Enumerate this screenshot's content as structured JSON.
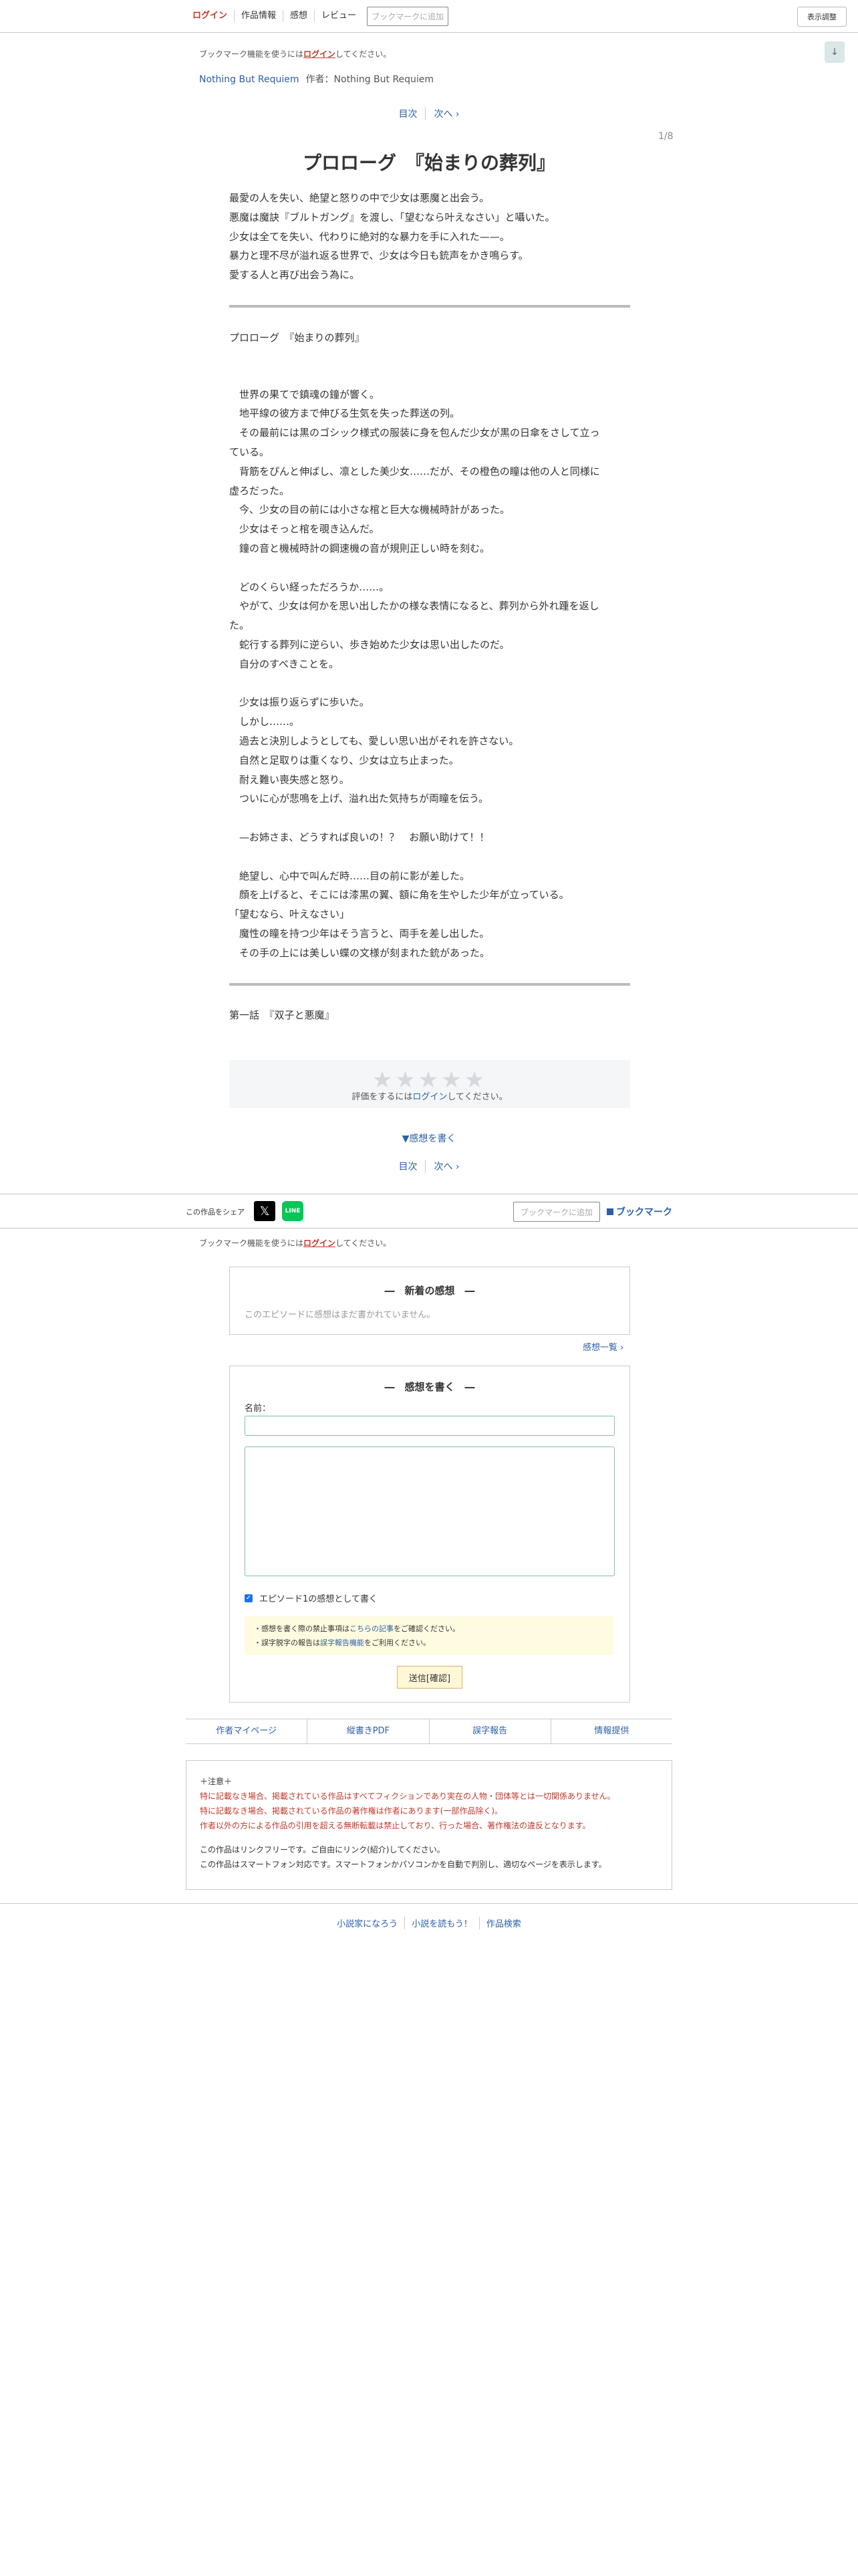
{
  "header": {
    "nav": [
      "ログイン",
      "作品情報",
      "感想",
      "レビュー"
    ],
    "bookmark_add": "ブックマークに追加",
    "display_settings": "表示調整"
  },
  "scroll_down": "↓",
  "bookmark_notice": {
    "pre": "ブックマーク機能を使うには",
    "link": "ログイン",
    "post": "してください。"
  },
  "work": {
    "title": "Nothing But Requiem",
    "author_label": "作者：",
    "author": "Nothing But Requiem"
  },
  "pager": {
    "toc": "目次",
    "next": "次へ ›"
  },
  "page_number": "1/8",
  "episode_title": "プロローグ　『始まりの葬列』",
  "preface": [
    "最愛の人を失い、絶望と怒りの中で少女は悪魔と出会う。",
    "悪魔は魔訣『ブルトガング』を渡し、「望むなら叶えなさい」と囁いた。",
    "少女は全てを失い、代わりに絶対的な暴力を手に入れた——。",
    "暴力と理不尽が溢れ返る世界で、少女は今日も銃声をかき鳴らす。",
    "愛する人と再び出会う為に。"
  ],
  "subtitle_repeat": "プロローグ　『始まりの葬列』",
  "body": [
    "",
    "",
    "　世界の果てで鎮魂の鐘が響く。",
    "　地平線の彼方まで伸びる生気を失った葬送の列。",
    "　その最前には黒のゴシック様式の服装に身を包んだ少女が黒の日傘をさして立っ",
    "ている。",
    "　背筋をぴんと伸ばし、凛とした美少女……だが、その橙色の瞳は他の人と同様に",
    "虚ろだった。",
    "　今、少女の目の前には小さな棺と巨大な機械時計があった。",
    "　少女はそっと棺を覗き込んだ。",
    "　鐘の音と機械時計の鋼速機の音が規則正しい時を刻む。",
    "",
    "　どのくらい経っただろうか……。",
    "　やがて、少女は何かを思い出したかの様な表情になると、葬列から外れ踵を返し",
    "た。",
    "　蛇行する葬列に逆らい、歩き始めた少女は思い出したのだ。",
    "　自分のすべきことを。",
    "",
    "　少女は振り返らずに歩いた。",
    "　しかし……。",
    "　過去と決別しようとしても、愛しい思い出がそれを許さない。",
    "　自然と足取りは重くなり、少女は立ち止まった。",
    "　耐え難い喪失感と怒り。",
    "　ついに心が悲鳴を上げ、溢れ出た気持ちが両瞳を伝う。",
    "",
    "　—お姉さま、どうすれば良いの！？　お願い助けて！！",
    "",
    "　絶望し、心中で叫んだ時……目の前に影が差した。",
    "　顔を上げると、そこには漆黒の翼、額に角を生やした少年が立っている。",
    "「望むなら、叶えなさい」",
    "　魔性の瞳を持つ少年はそう言うと、両手を差し出した。",
    "　その手の上には美しい蝶の文様が刻まれた銃があった。"
  ],
  "next_episode": "第一話　『双子と悪魔』",
  "rating": {
    "stars": "★★★★★",
    "pre": "評価をするには",
    "link": "ログイン",
    "post": "してください。"
  },
  "write_toggle": "▼感想を書く",
  "share": {
    "label": "この作品をシェア",
    "x_icon": "𝕏",
    "line_icon": "LINE",
    "bookmark_add": "ブックマークに追加",
    "bookmark": "ブックマーク"
  },
  "latest": {
    "title": "―　新着の感想　―",
    "empty": "このエピソードに感想はまだ書かれていません。"
  },
  "list_link": "感想一覧 ›",
  "form": {
    "title": "―　感想を書く　―",
    "name_label": "名前：",
    "checkbox_label": "エピソード1の感想として書く",
    "note1_pre": "・感想を書く際の禁止事項は",
    "note1_link": "こちらの記事",
    "note1_post": "をご確認ください。",
    "note2_pre": "・誤字脱字の報告は",
    "note2_link": "誤字報告機能",
    "note2_post": "をご利用ください。",
    "submit": "送信[確認]"
  },
  "footnav": [
    "作者マイページ",
    "縦書きPDF",
    "誤字報告",
    "情報提供"
  ],
  "caution": {
    "head": "＋注意＋",
    "red": [
      "特に記載なき場合、掲載されている作品はすべてフィクションであり実在の人物・団体等とは一切関係ありません。",
      "特に記載なき場合、掲載されている作品の著作権は作者にあります(一部作品除く)。",
      "作者以外の方による作品の引用を超える無断転載は禁止しており、行った場合、著作権法の違反となります。"
    ],
    "gray": [
      "この作品はリンクフリーです。ご自由にリンク(紹介)してください。",
      "この作品はスマートフォン対応です。スマートフォンかパソコンかを自動で判別し、適切なページを表示します。"
    ]
  },
  "bottomnav": [
    "小説家になろう",
    "小説を読もう！",
    "作品検索"
  ]
}
